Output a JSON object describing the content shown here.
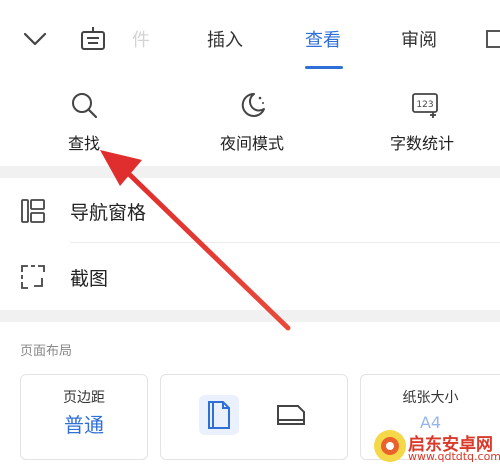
{
  "toolbar": {
    "faded_tab": "件",
    "tabs": [
      {
        "label": "插入",
        "active": false
      },
      {
        "label": "查看",
        "active": true
      },
      {
        "label": "审阅",
        "active": false
      }
    ]
  },
  "quick_actions": [
    {
      "label": "查找",
      "icon": "search-icon"
    },
    {
      "label": "夜间模式",
      "icon": "moon-icon"
    },
    {
      "label": "字数统计",
      "icon": "word-count-icon"
    }
  ],
  "menu": [
    {
      "label": "导航窗格",
      "icon": "navigation-pane-icon"
    },
    {
      "label": "截图",
      "icon": "screenshot-icon"
    }
  ],
  "page_layout": {
    "title": "页面布局",
    "margins_label": "页边距",
    "margins_value": "普通",
    "paper_size_label": "纸张大小",
    "paper_size_value": "A4"
  },
  "watermark": {
    "text": "启东安卓网",
    "url": "www.qdtdtq.com"
  },
  "colors": {
    "accent": "#2f6fd8",
    "annotation_arrow": "#e02d2d",
    "watermark": "#d93a2a"
  }
}
